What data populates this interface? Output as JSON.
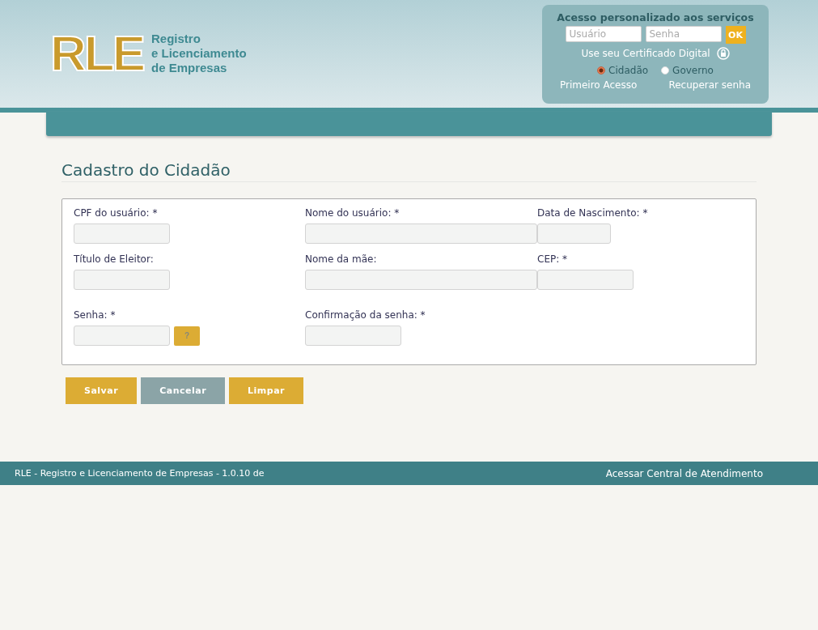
{
  "header": {
    "logo": "RLE",
    "brand_lines": [
      "Registro",
      "e Licenciamento",
      "de Empresas"
    ]
  },
  "login": {
    "title": "Acesso personalizado aos serviços",
    "user": {
      "placeholder": "Usuário"
    },
    "password": {
      "placeholder": "Senha"
    },
    "ok": "OK",
    "certificate": "Use seu Certificado Digital",
    "profiles": [
      {
        "label": "Cidadão",
        "selected": true
      },
      {
        "label": "Governo",
        "selected": false
      }
    ],
    "links": [
      "Primeiro Acesso",
      "Recuperar senha"
    ]
  },
  "page_title": "Cadastro do Cidadão",
  "form_rows": [
    [
      {
        "label": "CPF do usuário:  *",
        "kind": "short"
      },
      {
        "label": "Nome do usuário:  *",
        "kind": "wide"
      },
      {
        "label": "Data de Nascimento: *",
        "kind": "date"
      }
    ],
    [
      {
        "label": "Título de Eleitor:",
        "kind": "short"
      },
      {
        "label": "Nome da mãe:",
        "kind": "wide"
      },
      {
        "label": "CEP:  *",
        "kind": "short"
      }
    ],
    [
      {
        "label": "Senha:  *",
        "kind": "short",
        "help": "?"
      },
      {
        "label": "Confirmação da senha:  *",
        "kind": "short"
      }
    ]
  ],
  "buttons": [
    {
      "label": "Salvar",
      "kind": "primary"
    },
    {
      "label": "Cancelar",
      "kind": "secondary"
    },
    {
      "label": "Limpar",
      "kind": "primary"
    }
  ],
  "footer": {
    "left": "RLE - Registro e Licenciamento de Empresas - 1.0.10 de",
    "right": "Acessar Central de Atendimento"
  }
}
